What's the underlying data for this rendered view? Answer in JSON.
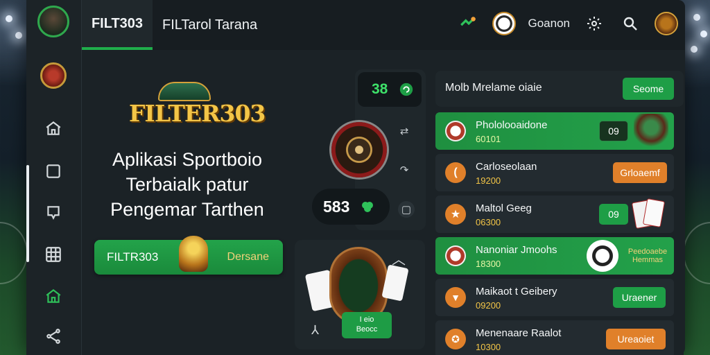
{
  "colors": {
    "accent_green": "#1fae4b",
    "accent_orange": "#e0802a",
    "gold": "#f3c547",
    "panel": "#1b2226"
  },
  "sidebar": {
    "items": [
      {
        "icon": "home-icon"
      },
      {
        "icon": "square-icon"
      },
      {
        "icon": "chat-icon"
      },
      {
        "icon": "grid-icon"
      },
      {
        "icon": "home-outline-icon"
      },
      {
        "icon": "share-icon"
      }
    ]
  },
  "topbar": {
    "tab_active": "FILT303",
    "tab_2": "FILTarol  Tarana",
    "user_label": "Goanon"
  },
  "hero": {
    "logo_text": "FILTER303",
    "title_line1": "Aplikasi Sportboio",
    "title_line2": "Terbaialk patur",
    "title_line3": "Pengemar Tarthen",
    "button_label": "FILTR303",
    "button_secondary": "Dersane"
  },
  "middle": {
    "score_1": "38",
    "score_2": "583",
    "game_chip_line1": "I eio",
    "game_chip_line2": "Beocc"
  },
  "right": {
    "header_title": "Molb Mrelame oiaie",
    "header_button": "Seome",
    "rows": [
      {
        "name": "Phololooaidone",
        "value": "60101",
        "action": "09",
        "style": "green",
        "action_style": "dark",
        "icon": "ball-icon"
      },
      {
        "name": "Carloseolaan",
        "value": "19200",
        "action": "Grloaemf",
        "style": "dark",
        "action_style": "orange",
        "icon": "coin-icon"
      },
      {
        "name": "Maltol Geeg",
        "value": "06300",
        "action": "09",
        "style": "dark",
        "action_style": "green",
        "icon": "star-icon"
      },
      {
        "name": "Nanoniar Jmoohs",
        "value": "18300",
        "action": "Peedoaebe Hemmas",
        "style": "green",
        "action_style": "none",
        "icon": "ball-icon"
      },
      {
        "name": "Maikaot t Geibery",
        "value": "09200",
        "action": "Uraener",
        "style": "dark",
        "action_style": "green",
        "icon": "shield-icon"
      },
      {
        "name": "Menenaare Raalot",
        "value": "10300",
        "action": "Ureaoiet",
        "style": "dark",
        "action_style": "orange",
        "icon": "crest-icon"
      }
    ]
  }
}
